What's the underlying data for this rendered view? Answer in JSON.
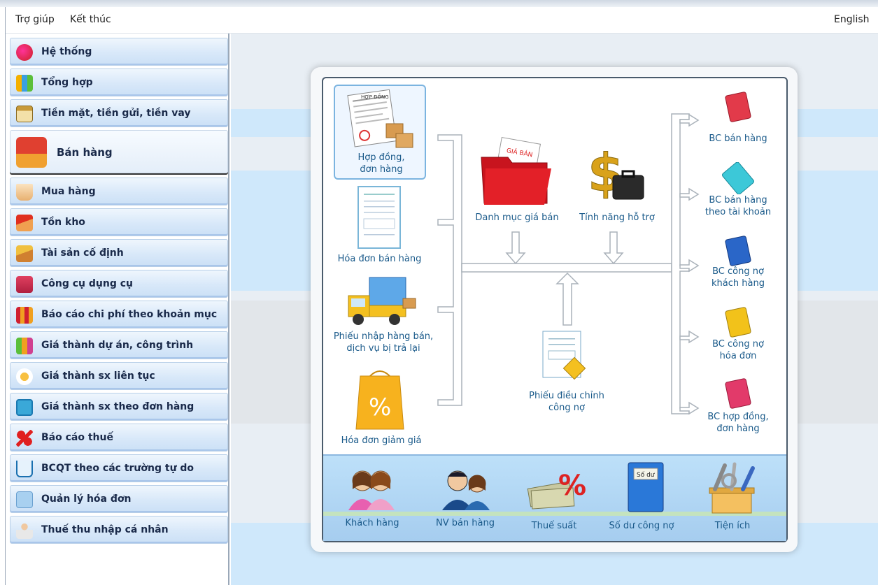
{
  "menubar": {
    "help": "Trợ giúp",
    "exit": "Kết thúc",
    "language": "English"
  },
  "sidebar": {
    "items": [
      {
        "label": "Hệ thống",
        "icon": "system-icon"
      },
      {
        "label": "Tổng hợp",
        "icon": "summary-icon"
      },
      {
        "label": "Tiền mặt, tiền gửi, tiền vay",
        "icon": "bank-icon"
      },
      {
        "label": "Bán hàng",
        "icon": "sales-truck-icon",
        "active": true
      },
      {
        "label": "Mua hàng",
        "icon": "shopping-basket-icon"
      },
      {
        "label": "Tồn kho",
        "icon": "warehouse-icon"
      },
      {
        "label": "Tài sản cố định",
        "icon": "fixed-asset-icon"
      },
      {
        "label": "Công cụ dụng cụ",
        "icon": "tools-icon"
      },
      {
        "label": "Báo cáo chi phí theo khoản mục",
        "icon": "cost-report-icon"
      },
      {
        "label": "Giá thành dự án, công trình",
        "icon": "project-cost-icon"
      },
      {
        "label": "Giá thành sx liên tục",
        "icon": "gears-icon"
      },
      {
        "label": "Giá thành sx theo đơn hàng",
        "icon": "calculator-icon"
      },
      {
        "label": "Báo cáo thuế",
        "icon": "percent-icon"
      },
      {
        "label": "BCQT theo các trường tự do",
        "icon": "cart-icon"
      },
      {
        "label": "Quản lý hóa đơn",
        "icon": "invoice-icon"
      },
      {
        "label": "Thuế thu nhập cá nhân",
        "icon": "person-icon"
      }
    ]
  },
  "diagram": {
    "contract_line1": "Hợp đồng,",
    "contract_line2": "đơn hàng",
    "contract_doc_header": "HỢP ĐỒNG",
    "sales_invoice": "Hóa đơn bán hàng",
    "return_line1": "Phiếu nhập hàng bán,",
    "return_line2": "dịch vụ bị trả lại",
    "discount_invoice": "Hóa đơn giảm giá",
    "price_list": "Danh mục giá bán",
    "price_tag": "GIÁ BÁN",
    "support": "Tính năng hỗ trợ",
    "adjust_line1": "Phiếu điều chỉnh",
    "adjust_line2": "công nợ",
    "reports": [
      {
        "line1": "BC bán hàng",
        "line2": "",
        "color": "#e23a4a"
      },
      {
        "line1": "BC bán hàng",
        "line2": "theo tài khoản",
        "color": "#3cc8d8"
      },
      {
        "line1": "BC công nợ",
        "line2": "khách hàng",
        "color": "#2a66c8"
      },
      {
        "line1": "BC công nợ",
        "line2": "hóa đơn",
        "color": "#f2c21a"
      },
      {
        "line1": "BC hợp đồng,",
        "line2": "đơn hàng",
        "color": "#e23a6a"
      }
    ]
  },
  "bottom": {
    "customers": "Khách hàng",
    "sales_staff": "NV bán hàng",
    "tax_rate": "Thuế suất",
    "debt_balance": "Số dư công nợ",
    "debt_book_label": "Số dư",
    "utilities": "Tiện ích"
  },
  "colors": {
    "accent_blue": "#1a5a8a",
    "band": "#cfe8fb"
  }
}
